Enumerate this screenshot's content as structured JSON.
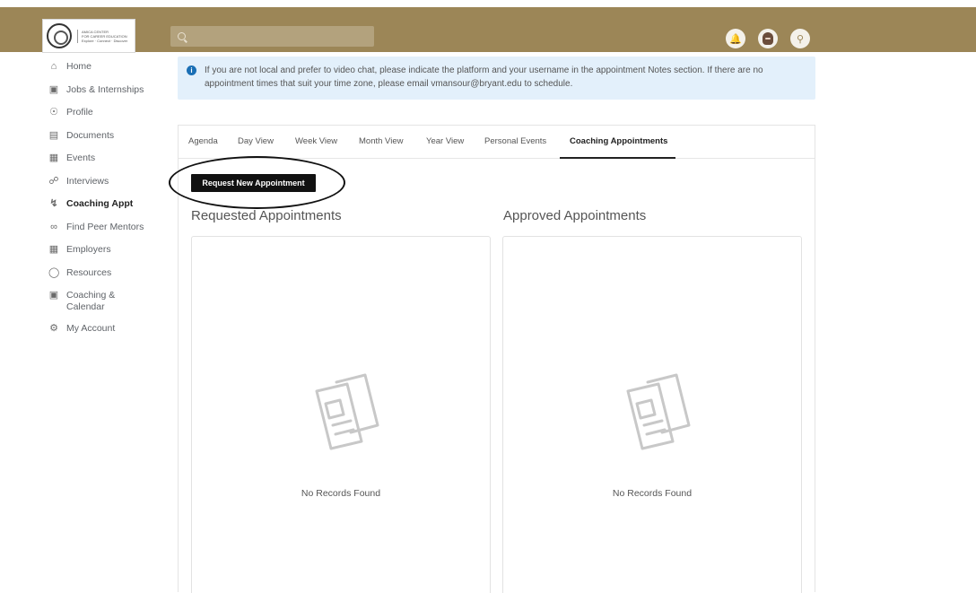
{
  "header": {
    "logo_lines": [
      "AMICA CENTER",
      "FOR CAREER EDUCATION",
      "Explore · Connect · Discover"
    ],
    "search_placeholder": ""
  },
  "sidebar": {
    "items": [
      {
        "label": "Home",
        "icon": "home-icon"
      },
      {
        "label": "Jobs & Internships",
        "icon": "briefcase-icon"
      },
      {
        "label": "Profile",
        "icon": "person-icon"
      },
      {
        "label": "Documents",
        "icon": "document-icon"
      },
      {
        "label": "Events",
        "icon": "calendar-icon"
      },
      {
        "label": "Interviews",
        "icon": "interviews-icon"
      },
      {
        "label": "Coaching Appt",
        "icon": "coaching-icon",
        "active": true
      },
      {
        "label": "Find Peer Mentors",
        "icon": "mentors-icon"
      },
      {
        "label": "Employers",
        "icon": "building-icon"
      },
      {
        "label": "Resources",
        "icon": "lightbulb-icon"
      },
      {
        "label": "Coaching & Calendar",
        "icon": "calendar-icon"
      },
      {
        "label": "My Account",
        "icon": "gear-icon"
      }
    ]
  },
  "alert": {
    "text": "If you are not local and prefer to video chat, please indicate the platform and your username in the appointment Notes section. If there are no appointment times that suit your time zone, please email vmansour@bryant.edu to schedule."
  },
  "tabs": [
    "Agenda",
    "Day View",
    "Week View",
    "Month View",
    "Year View",
    "Personal Events",
    "Coaching Appointments"
  ],
  "active_tab": "Coaching Appointments",
  "main": {
    "request_button": "Request New Appointment",
    "requested_title": "Requested Appointments",
    "approved_title": "Approved Appointments",
    "requested_empty": "No Records Found",
    "approved_empty": "No Records Found"
  },
  "colors": {
    "header": "#9c8657",
    "alert_bg": "#e3f0fb",
    "info_icon": "#1a6fb5",
    "button": "#111111"
  }
}
